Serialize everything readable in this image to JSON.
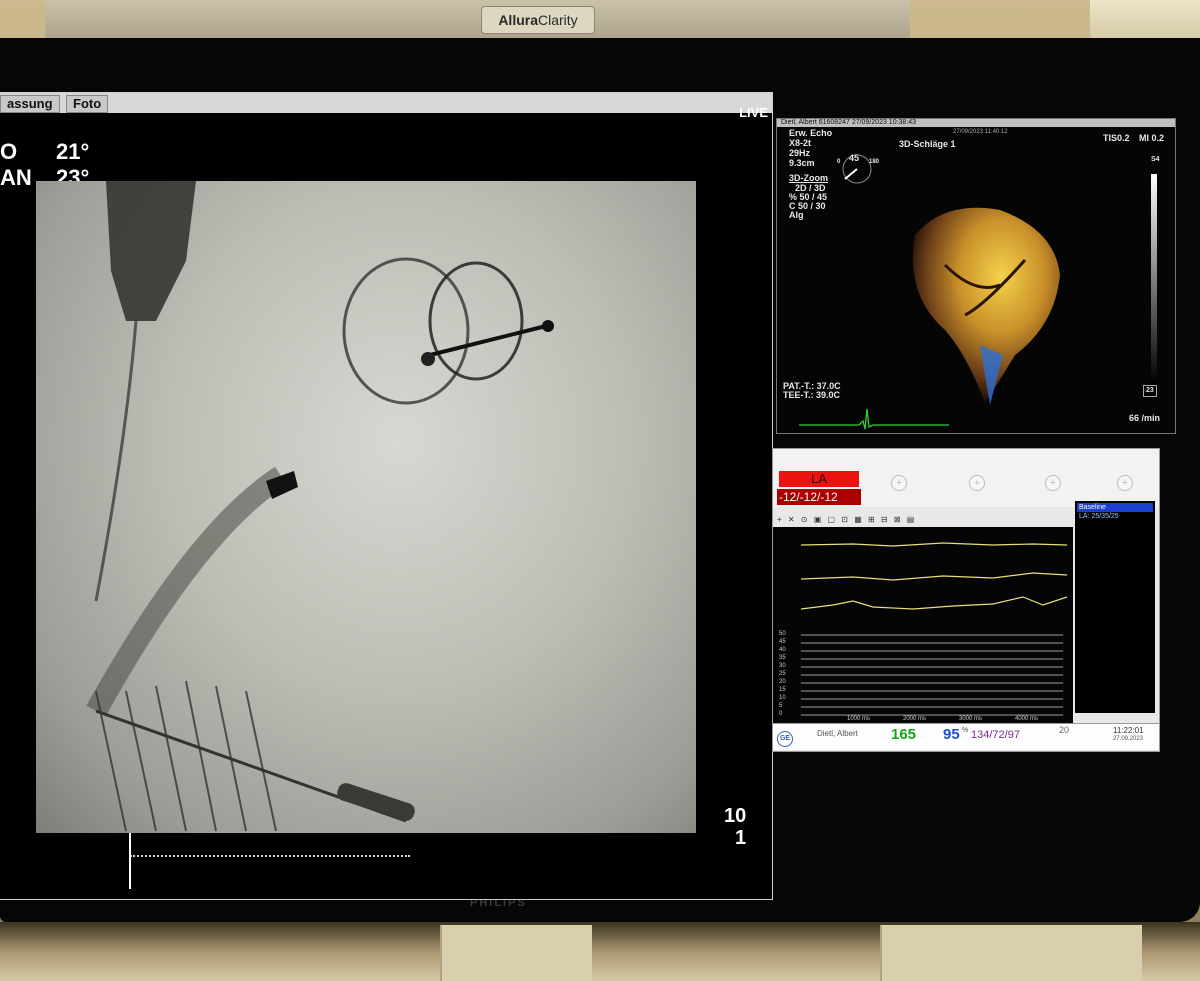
{
  "brand": {
    "part1": "Allura",
    "part2": "Clarity"
  },
  "monitor": {
    "logo": "PHILIPS"
  },
  "fluoro": {
    "tabs": [
      "assung",
      "Foto"
    ],
    "live_label": "LIVE",
    "angle1": {
      "label": "O",
      "value": "21°"
    },
    "angle2": {
      "label": "AN",
      "value": "23°"
    },
    "counter_top": "10",
    "counter_bottom": "1"
  },
  "echo": {
    "header": "Dietl, Albert 61608247 27/09/2023 10:38:43",
    "header_time": "27/09/2023 11:40:12",
    "mode_lines": [
      "Erw. Echo",
      "X8-2t",
      "29Hz",
      "9.3cm"
    ],
    "probe_angle": "45",
    "probe_min": "0",
    "probe_max": "180",
    "view_label": "3D-Schläge 1",
    "tis": "TIS0.2",
    "mi": "MI 0.2",
    "s4": "S4",
    "zoom_title": "3D-Zoom",
    "zoom_lines": [
      "2D / 3D",
      "% 50 / 45",
      "C 50 / 30",
      "Alg"
    ],
    "pat_temp": "PAT.-T.: 37.0C",
    "tee_temp": "TEE-T.: 39.0C",
    "badge": "23",
    "heart_rate": "66 /min"
  },
  "hemo": {
    "channel": "LA",
    "channel_values": "-12/-12/-12",
    "toolbar": "+ ✕ ⊙ ▣ ▢ ⊡ ▦ ⊞ ⊟ ⊠ ▤",
    "baseline_title": "Baseline",
    "baseline_value": "LA: 25/35/25",
    "y_ticks": [
      "50",
      "45",
      "40",
      "35",
      "30",
      "25",
      "20",
      "15",
      "10",
      "5",
      "0"
    ],
    "x_ticks": [
      "1000 ms",
      "2000 ms",
      "3000 ms",
      "4000 ms"
    ],
    "patient": "Dietl, Albert",
    "hr": "165",
    "spo2": "95",
    "spo2_unit": "%",
    "nibp": "134/72/97",
    "resp": "20",
    "time": "11:22:01",
    "date": "27.09.2023",
    "vendor": "GE"
  }
}
